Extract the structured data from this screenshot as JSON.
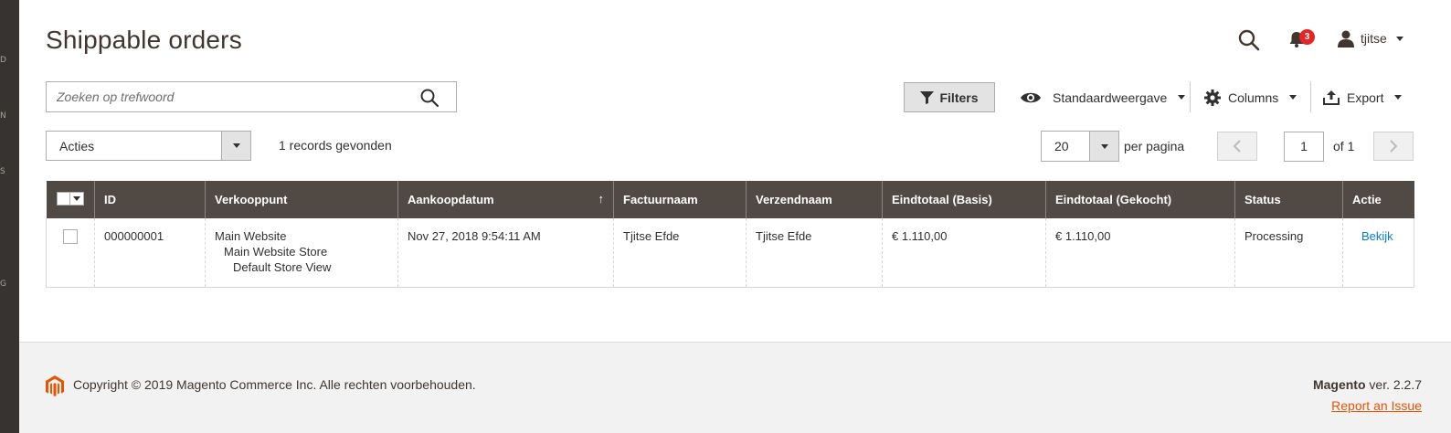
{
  "sidebar": {
    "letters": [
      "D",
      "N",
      "S",
      "G"
    ]
  },
  "header": {
    "title": "Shippable orders",
    "notification_count": "3",
    "username": "tjitse"
  },
  "search": {
    "placeholder": "Zoeken op trefwoord",
    "value": ""
  },
  "toolbar": {
    "filters_label": "Filters",
    "view_label": "Standaardweergave",
    "columns_label": "Columns",
    "export_label": "Export"
  },
  "mass_actions": {
    "label": "Acties",
    "records_found": "1 records gevonden"
  },
  "pagination": {
    "per_page": "20",
    "per_page_label": "per pagina",
    "current_page": "1",
    "of_label": "of 1",
    "prev_icon": "chevron-left-icon",
    "next_icon": "chevron-right-icon"
  },
  "grid": {
    "columns": [
      "ID",
      "Verkooppunt",
      "Aankoopdatum",
      "Factuurnaam",
      "Verzendnaam",
      "Eindtotaal (Basis)",
      "Eindtotaal (Gekocht)",
      "Status",
      "Actie"
    ],
    "sort_indicator": "↑",
    "rows": [
      {
        "id": "000000001",
        "store": [
          "Main Website",
          "Main Website Store",
          "Default Store View"
        ],
        "date": "Nov 27, 2018 9:54:11 AM",
        "bill_name": "Tjitse Efde",
        "ship_name": "Tjitse Efde",
        "total_base": "€ 1.110,00",
        "total_purchased": "€ 1.110,00",
        "status": "Processing",
        "action": "Bekijk"
      }
    ]
  },
  "footer": {
    "copyright": "Copyright © 2019 Magento Commerce Inc. Alle rechten voorbehouden.",
    "brand": "Magento",
    "version": " ver. 2.2.7",
    "report_link": "Report an Issue"
  },
  "colors": {
    "header_bg": "#514943",
    "link": "#007bdb",
    "badge": "#e22626",
    "footer_link": "#eb5202",
    "sidebar": "#373330"
  }
}
